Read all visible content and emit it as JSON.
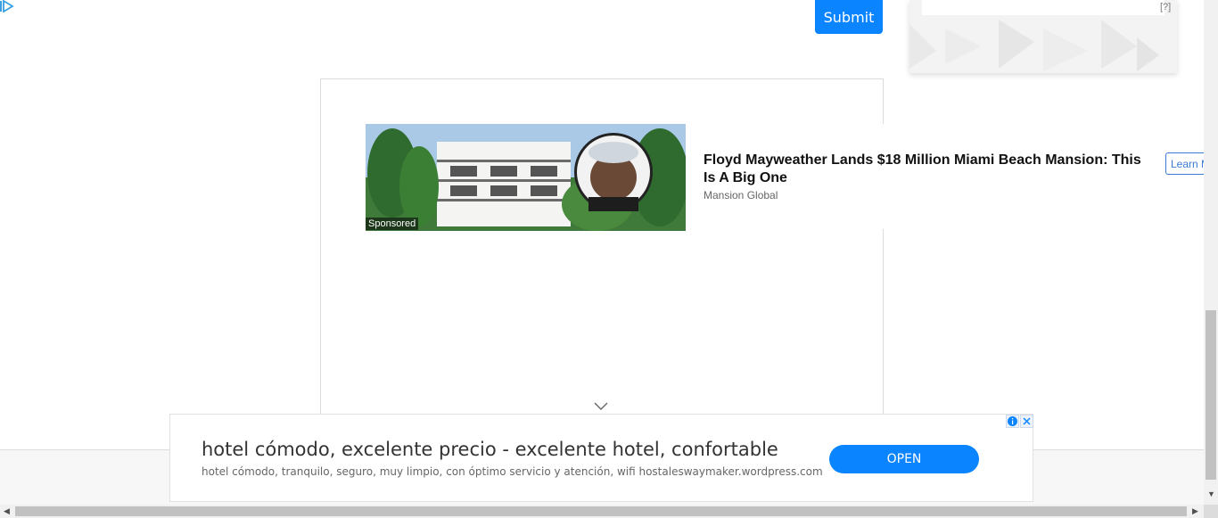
{
  "form": {
    "submit_label": "Submit"
  },
  "side_ad": {
    "help_label": "[?]"
  },
  "sponsored_card": {
    "badge": "Sponsored",
    "title": "Floyd Mayweather Lands $18 Million Miami Beach Mansion: This Is A Big One",
    "source": "Mansion Global",
    "cta_label": "Learn More"
  },
  "bottom_ad": {
    "headline": "hotel cómodo, excelente precio - excelente hotel, confortable",
    "description": "hotel cómodo, tranquilo, seguro, muy limpio, con óptimo servicio y atención, wifi hostaleswaymaker.wordpress.com",
    "open_label": "OPEN"
  },
  "colors": {
    "accent": "#0a84ff",
    "learn_more": "#3a7bd5"
  }
}
